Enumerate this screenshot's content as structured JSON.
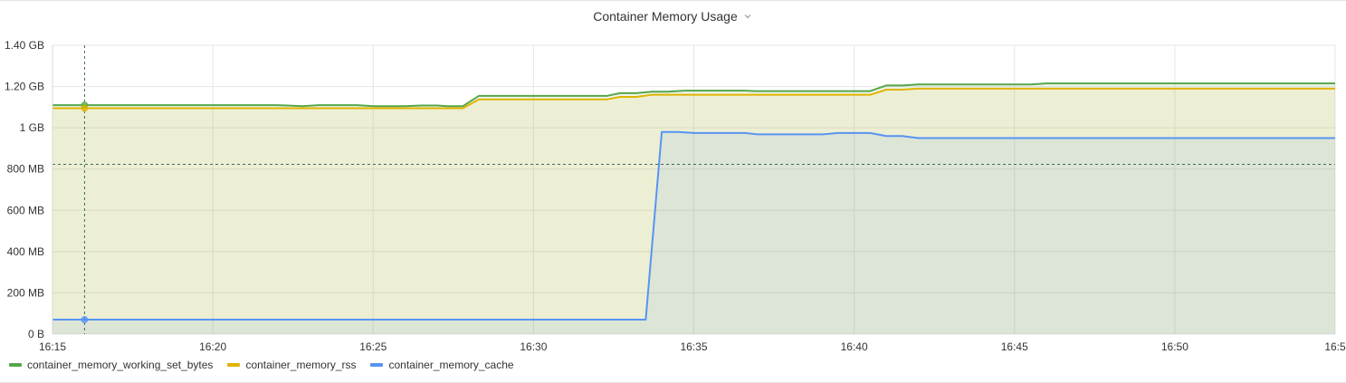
{
  "panel": {
    "title": "Container Memory Usage"
  },
  "colors": {
    "working_set": "#56a64b",
    "rss": "#e0b400",
    "cache": "#5794f2",
    "grid": "#e6e6e6",
    "threshold": "#3d6b5c"
  },
  "chart_data": {
    "type": "line",
    "title": "Container Memory Usage",
    "xlabel": "",
    "ylabel": "",
    "x_ticks": [
      "16:15",
      "16:20",
      "16:25",
      "16:30",
      "16:35",
      "16:40",
      "16:45",
      "16:50",
      "16:5"
    ],
    "y_ticks": [
      "0 B",
      "200 MB",
      "400 MB",
      "600 MB",
      "800 MB",
      "1 GB",
      "1.20 GB",
      "1.40 GB"
    ],
    "xlim_minutes": [
      0,
      40
    ],
    "ylim_mb": [
      0,
      1400
    ],
    "x_unit": "minutes after 16:15",
    "y_unit": "MB",
    "grid": true,
    "legend_position": "bottom-left",
    "crosshair_x": 1.0,
    "threshold_y": 823,
    "series": [
      {
        "name": "container_memory_working_set_bytes",
        "color_key": "working_set",
        "fill": true,
        "points": [
          [
            0,
            1110
          ],
          [
            7,
            1110
          ],
          [
            7.3,
            1108
          ],
          [
            7.8,
            1105
          ],
          [
            8.3,
            1110
          ],
          [
            9.5,
            1110
          ],
          [
            10,
            1105
          ],
          [
            11,
            1105
          ],
          [
            11.5,
            1108
          ],
          [
            12,
            1108
          ],
          [
            12.3,
            1105
          ],
          [
            12.8,
            1105
          ],
          [
            13.3,
            1155
          ],
          [
            17.3,
            1155
          ],
          [
            17.7,
            1168
          ],
          [
            18.2,
            1168
          ],
          [
            18.7,
            1175
          ],
          [
            19.2,
            1175
          ],
          [
            19.7,
            1180
          ],
          [
            21.6,
            1180
          ],
          [
            21.9,
            1178
          ],
          [
            25.5,
            1178
          ],
          [
            26,
            1205
          ],
          [
            26.5,
            1205
          ],
          [
            27,
            1210
          ],
          [
            30.5,
            1210
          ],
          [
            31,
            1215
          ],
          [
            40,
            1215
          ]
        ]
      },
      {
        "name": "container_memory_rss",
        "color_key": "rss",
        "fill": true,
        "points": [
          [
            0,
            1095
          ],
          [
            12.8,
            1095
          ],
          [
            13.3,
            1138
          ],
          [
            17.3,
            1138
          ],
          [
            17.7,
            1150
          ],
          [
            18.2,
            1150
          ],
          [
            18.7,
            1160
          ],
          [
            25.5,
            1160
          ],
          [
            26,
            1185
          ],
          [
            26.5,
            1185
          ],
          [
            27,
            1190
          ],
          [
            40,
            1190
          ]
        ]
      },
      {
        "name": "container_memory_cache",
        "color_key": "cache",
        "fill": true,
        "points": [
          [
            0,
            70
          ],
          [
            18.5,
            70
          ],
          [
            19,
            980
          ],
          [
            19.5,
            980
          ],
          [
            20,
            975
          ],
          [
            21.6,
            975
          ],
          [
            22,
            968
          ],
          [
            24,
            968
          ],
          [
            24.5,
            975
          ],
          [
            25.5,
            975
          ],
          [
            26,
            960
          ],
          [
            26.5,
            960
          ],
          [
            27,
            950
          ],
          [
            40,
            950
          ]
        ]
      }
    ]
  }
}
